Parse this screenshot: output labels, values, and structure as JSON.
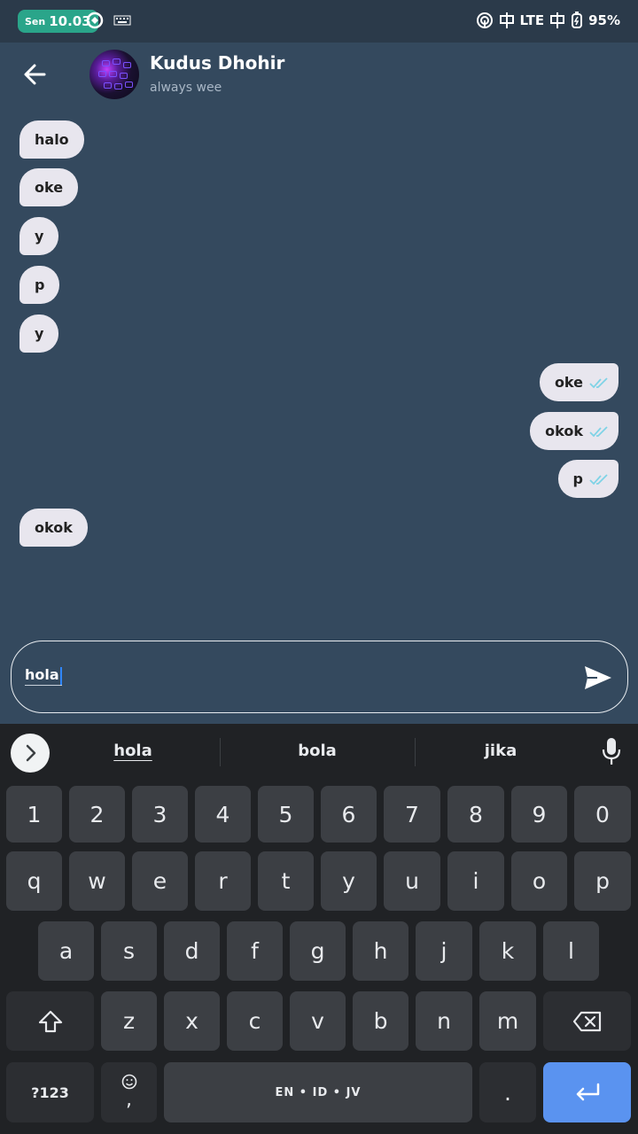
{
  "status_bar": {
    "day": "Sen",
    "time": "10.03",
    "network": "LTE",
    "battery": "95%"
  },
  "header": {
    "contact_name": "Kudus Dhohir",
    "contact_status": "always wee"
  },
  "messages": [
    {
      "direction": "in",
      "text": "halo"
    },
    {
      "direction": "in",
      "text": "oke"
    },
    {
      "direction": "in",
      "text": "y"
    },
    {
      "direction": "in",
      "text": "p"
    },
    {
      "direction": "in",
      "text": "y"
    },
    {
      "direction": "out",
      "text": "oke",
      "status": "read"
    },
    {
      "direction": "out",
      "text": "okok",
      "status": "read"
    },
    {
      "direction": "out",
      "text": "p",
      "status": "read"
    },
    {
      "direction": "in",
      "text": "okok"
    }
  ],
  "composer": {
    "value": "hola"
  },
  "keyboard": {
    "suggestions": [
      "hola",
      "bola",
      "jika"
    ],
    "row_numbers": [
      "1",
      "2",
      "3",
      "4",
      "5",
      "6",
      "7",
      "8",
      "9",
      "0"
    ],
    "row_top": [
      "q",
      "w",
      "e",
      "r",
      "t",
      "y",
      "u",
      "i",
      "o",
      "p"
    ],
    "row_middle": [
      "a",
      "s",
      "d",
      "f",
      "g",
      "h",
      "j",
      "k",
      "l"
    ],
    "row_bottom": [
      "z",
      "x",
      "c",
      "v",
      "b",
      "n",
      "m"
    ],
    "symbols_label": "?123",
    "comma_label": ",",
    "space_label": "EN • ID • JV",
    "period_label": "."
  },
  "colors": {
    "chat_background": "#34495e",
    "bubble": "#e8e6ee",
    "read_ticks": "#7fd3e6",
    "time_pill": "#2aa58a",
    "enter_key": "#5a93f0"
  }
}
